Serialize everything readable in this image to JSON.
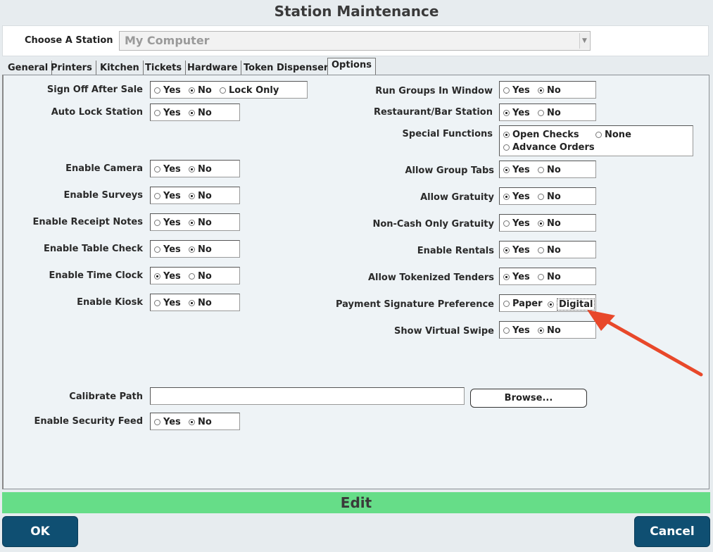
{
  "window": {
    "title": "Station Maintenance"
  },
  "station": {
    "label": "Choose A Station",
    "selected": "My Computer"
  },
  "tabs": [
    "General",
    "Printers",
    "Kitchen",
    "Tickets",
    "Hardware",
    "Token Dispenser",
    "Options"
  ],
  "active_tab": "Options",
  "left_options": [
    {
      "label": "Sign Off After Sale",
      "choices": [
        "Yes",
        "No",
        "Lock Only"
      ],
      "selected": "No"
    },
    {
      "label": "Auto Lock Station",
      "choices": [
        "Yes",
        "No"
      ],
      "selected": "No"
    },
    {
      "label": "Enable Camera",
      "choices": [
        "Yes",
        "No"
      ],
      "selected": "No"
    },
    {
      "label": "Enable Surveys",
      "choices": [
        "Yes",
        "No"
      ],
      "selected": "No"
    },
    {
      "label": "Enable Receipt Notes",
      "choices": [
        "Yes",
        "No"
      ],
      "selected": "No"
    },
    {
      "label": "Enable Table Check",
      "choices": [
        "Yes",
        "No"
      ],
      "selected": "No"
    },
    {
      "label": "Enable Time Clock",
      "choices": [
        "Yes",
        "No"
      ],
      "selected": "Yes"
    },
    {
      "label": "Enable Kiosk",
      "choices": [
        "Yes",
        "No"
      ],
      "selected": "No"
    }
  ],
  "right_options": [
    {
      "label": "Run Groups In Window",
      "choices": [
        "Yes",
        "No"
      ],
      "selected": "No"
    },
    {
      "label": "Restaurant/Bar Station",
      "choices": [
        "Yes",
        "No"
      ],
      "selected": "Yes"
    },
    {
      "label": "Special Functions",
      "choices": [
        "Open Checks",
        "None",
        "Advance Orders"
      ],
      "selected": "Open Checks"
    },
    {
      "label": "Allow Group Tabs",
      "choices": [
        "Yes",
        "No"
      ],
      "selected": "Yes"
    },
    {
      "label": "Allow Gratuity",
      "choices": [
        "Yes",
        "No"
      ],
      "selected": "Yes"
    },
    {
      "label": "Non-Cash Only Gratuity",
      "choices": [
        "Yes",
        "No"
      ],
      "selected": "No"
    },
    {
      "label": "Enable Rentals",
      "choices": [
        "Yes",
        "No"
      ],
      "selected": "Yes"
    },
    {
      "label": "Allow Tokenized Tenders",
      "choices": [
        "Yes",
        "No"
      ],
      "selected": "Yes"
    },
    {
      "label": "Payment Signature Preference",
      "choices": [
        "Paper",
        "Digital"
      ],
      "selected": "Digital"
    },
    {
      "label": "Show Virtual Swipe",
      "choices": [
        "Yes",
        "No"
      ],
      "selected": "No"
    }
  ],
  "calibrate": {
    "label": "Calibrate Path",
    "value": "",
    "browse_label": "Browse..."
  },
  "security_feed": {
    "label": "Enable Security Feed",
    "choices": [
      "Yes",
      "No"
    ],
    "selected": "No"
  },
  "edit_bar": {
    "label": "Edit"
  },
  "buttons": {
    "ok": "OK",
    "cancel": "Cancel"
  },
  "colors": {
    "accent_button": "#0f4f72",
    "edit_bar": "#66dd88",
    "annotation_arrow": "#e8482a"
  },
  "icons": {
    "dropdown": "chevron-down-icon",
    "annotation": "arrow-icon"
  }
}
